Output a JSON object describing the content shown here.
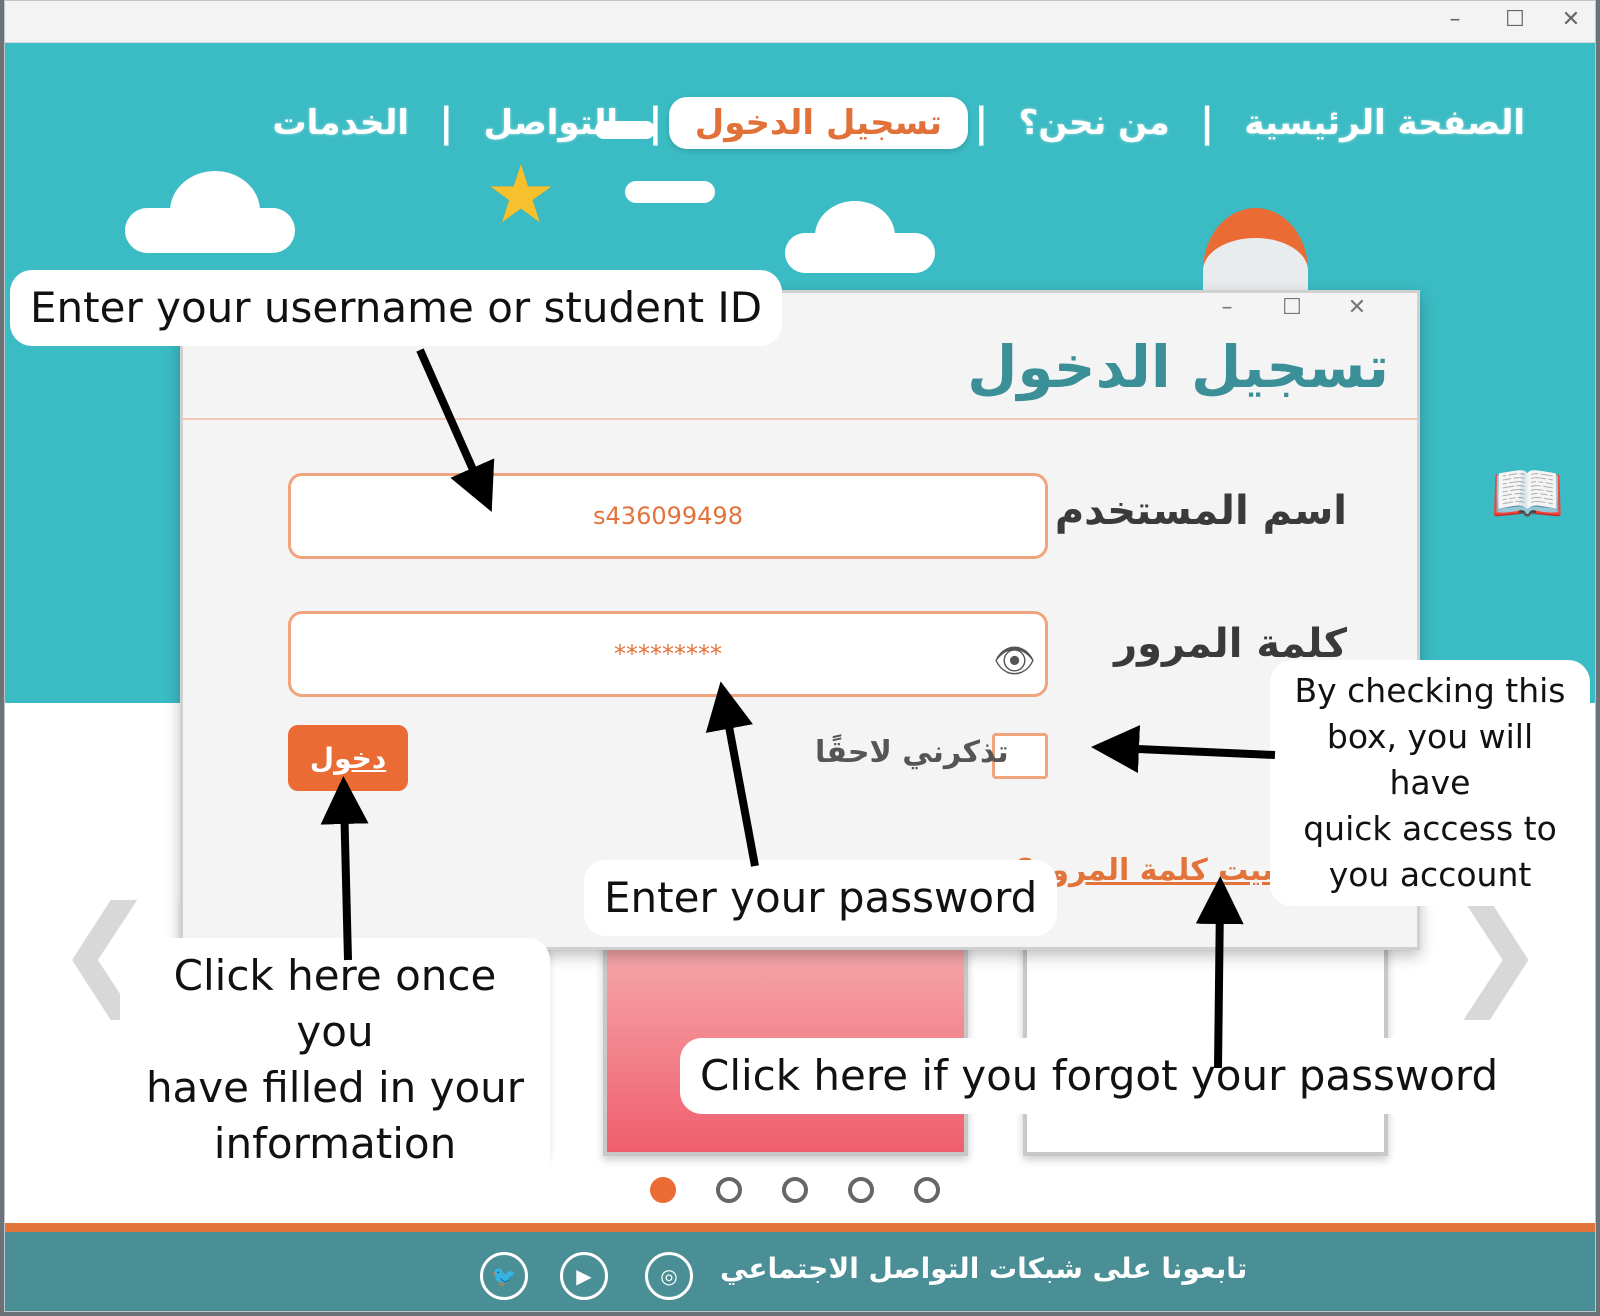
{
  "window": {
    "minimize": "–",
    "maximize": "☐",
    "close": "✕"
  },
  "nav": {
    "items": [
      "الصفحة الرئيسية",
      "من نحن؟",
      "تسجيل الدخول",
      "التواصل",
      "الخدمات"
    ],
    "separator": "|",
    "active_index": 2
  },
  "dialog": {
    "title": "تسجيل الدخول",
    "username_label": "اسم المستخدم",
    "username_value": "s436099498",
    "password_label": "كلمة المرور",
    "password_value": "*********",
    "remember_label": "تذكرني لاحقًا",
    "login_label": "دخول",
    "forgot_label": "هل نسيت كلمة المرور؟",
    "controls": {
      "minimize": "–",
      "maximize": "☐",
      "close": "✕"
    }
  },
  "carousel": {
    "prev": "❮",
    "next": "❯",
    "dot_count": 5,
    "active_dot": 0
  },
  "footer": {
    "text": "تابعونا على شبكات التواصل الاجتماعي",
    "social_icons": [
      "instagram-icon",
      "youtube-icon",
      "twitter-icon"
    ]
  },
  "annotations": {
    "username": "Enter your username or student ID",
    "password": "Enter your password",
    "remember": [
      "By checking this",
      "box, you will have",
      "quick access to",
      "you account"
    ],
    "login": [
      "Click here once you",
      "have filled in your",
      "information"
    ],
    "forgot": "Click here if you forgot your password"
  },
  "colors": {
    "teal": "#3bbbc3",
    "orange": "#ea6b33",
    "footer": "#4b8f96",
    "title": "#3b8f96"
  }
}
